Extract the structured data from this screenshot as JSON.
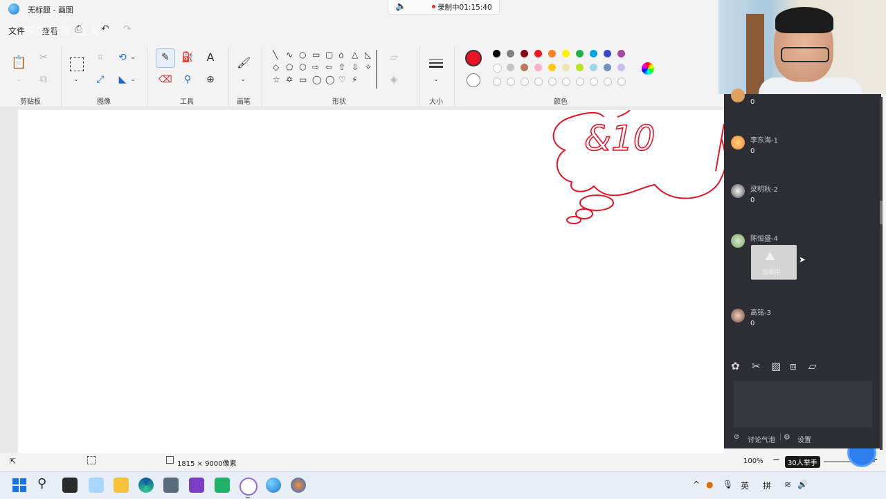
{
  "window": {
    "title": "无标题 - 画图"
  },
  "recording": {
    "label": "录制中01:15:40"
  },
  "menu": {
    "file": "文件",
    "view": "查看",
    "overlay": "陈智语言 盒人"
  },
  "ribbon": {
    "groups": {
      "clipboard": "剪贴板",
      "image": "图像",
      "tools": "工具",
      "brushes": "画笔",
      "shapes": "形状",
      "size": "大小",
      "colors": "颜色"
    },
    "text_tool_glyph": "A",
    "primary_color": "#e81224",
    "secondary_color": "#ffffff",
    "palette_row1": [
      "#000000",
      "#7f7f7f",
      "#880015",
      "#ed1c24",
      "#ff7f27",
      "#fff200",
      "#22b14c",
      "#00a2e8",
      "#3f48cc",
      "#a349a4"
    ],
    "palette_row2": [
      "#ffffff",
      "#c3c3c3",
      "#b97a57",
      "#ffaec9",
      "#ffc90e",
      "#efe4b0",
      "#b5e61d",
      "#99d9ea",
      "#7092be",
      "#c8bfe7"
    ],
    "shapes": [
      "╲",
      "∿",
      "○",
      "▭",
      "▢",
      "⌂",
      "△",
      "◺",
      "◇",
      "⬠",
      "⬡",
      "⇨",
      "⇦",
      "⇧",
      "⇩",
      "✧",
      "☆",
      "✡",
      "▭",
      "◯",
      "◯",
      "♡",
      "⚡"
    ]
  },
  "canvas": {
    "drawing_text": "&10",
    "stroke_color": "#e81224"
  },
  "status": {
    "dimensions": "1815 × 9000像素",
    "zoom": "100%",
    "raise_hand": "30人举手"
  },
  "chat": {
    "messages": [
      {
        "name": "",
        "text": "0"
      },
      {
        "name": "李东海-1",
        "text": "0"
      },
      {
        "name": "梁明秋-2",
        "text": "0"
      },
      {
        "name": "陈恒盛-4",
        "image_caption": "加载中"
      },
      {
        "name": "高铭-3",
        "text": "0"
      }
    ],
    "footer": {
      "bubble": "讨论气泡",
      "settings": "设置"
    }
  },
  "taskbar": {
    "lang1": "英",
    "lang2": "拼"
  }
}
